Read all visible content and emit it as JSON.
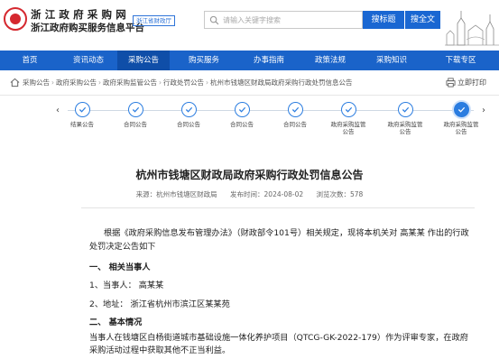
{
  "header": {
    "title_line1": "浙江政府采购网",
    "title_line2": "浙江政府购买服务信息平台",
    "region_tag": "浙江省财政厅",
    "search_placeholder": "请输入关键字搜索",
    "search_title_button": "搜标题",
    "search_all_button": "搜全文"
  },
  "nav": {
    "items": [
      "首页",
      "资讯动态",
      "采购公告",
      "购买服务",
      "办事指南",
      "政策法规",
      "采购知识",
      "下载专区"
    ],
    "active_index": 2
  },
  "breadcrumb": {
    "items": [
      "采购公告",
      "政府采购公告",
      "政府采购监管公告",
      "行政处罚公告",
      "杭州市钱塘区财政局政府采购行政处罚信息公告"
    ],
    "print_label": "立即打印"
  },
  "timeline": {
    "steps": [
      {
        "label": "结果公告"
      },
      {
        "label": "合同公告"
      },
      {
        "label": "合同公告"
      },
      {
        "label": "合同公告"
      },
      {
        "label": "合同公告"
      },
      {
        "label": "政府采购监管公告"
      },
      {
        "label": "政府采购监管公告"
      },
      {
        "label": "政府采购监管公告"
      }
    ],
    "current_index": 7
  },
  "article": {
    "title": "杭州市钱塘区财政局政府采购行政处罚信息公告",
    "source_label": "来源：杭州市钱塘区财政局",
    "date_label": "发布时间：2024-08-02",
    "views_label": "浏览次数：578",
    "paragraph1": "根据《政府采购信息发布管理办法》（财政部令101号）相关规定，现将本机关对 高某某 作出的行政处罚决定公告如下",
    "section1_heading": "一、 相关当事人",
    "party_line": "1、当事人： 高某某",
    "address_line": "2、地址： 浙江省杭州市滨江区某某苑",
    "section2_heading": "二、 基本情况",
    "paragraph2": "当事人在钱塘区白杨街道城市基础设施一体化养护项目（QTCG-GK-2022-179）作为评审专家，在政府采购活动过程中获取其他不正当利益。"
  }
}
